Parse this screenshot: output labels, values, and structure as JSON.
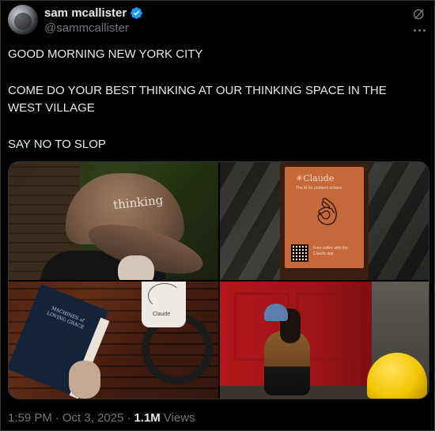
{
  "author": {
    "name": "sam mcallister",
    "handle": "@sammcallister",
    "verified": true,
    "verified_color": "#1d9bf0"
  },
  "tweet": {
    "lines": [
      "GOOD MORNING NEW YORK CITY",
      "COME DO YOUR BEST THINKING AT OUR THINKING SPACE IN THE WEST VILLAGE",
      "SAY NO TO SLOP"
    ]
  },
  "photos": {
    "p1": {
      "cap_text": "thinking"
    },
    "p2": {
      "brand": "✳Claude",
      "tagline": "The AI for problem solvers",
      "coffee_text": "Free coffee with the Claude app"
    },
    "p3": {
      "book_title": "MACHINES of LOVING GRACE",
      "cup_text": "Claude"
    }
  },
  "meta": {
    "time": "1:59 PM",
    "sep1": "·",
    "date": "Oct 3, 2025",
    "sep2": "·",
    "views_count": "1.1M",
    "views_label": "Views"
  },
  "icons": {
    "grok": "grok-icon",
    "more": "more-icon",
    "verified": "verified-badge-icon"
  },
  "colors": {
    "background": "#000000",
    "text": "#e7e9ea",
    "secondary_text": "#71767b",
    "border": "#2f3336"
  }
}
